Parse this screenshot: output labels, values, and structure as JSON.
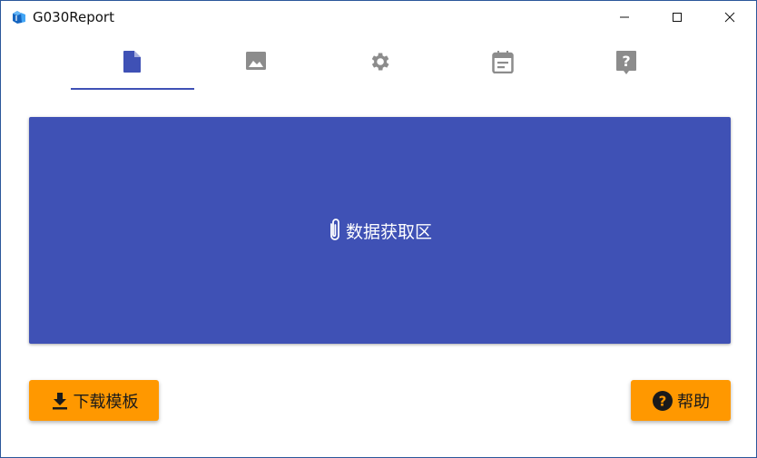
{
  "window": {
    "title": "G030Report"
  },
  "tabs": [
    {
      "icon": "file-icon",
      "active": true
    },
    {
      "icon": "image-icon",
      "active": false
    },
    {
      "icon": "gear-icon",
      "active": false
    },
    {
      "icon": "calendar-icon",
      "active": false
    },
    {
      "icon": "help-chat-icon",
      "active": false
    }
  ],
  "drop_area": {
    "label": "数据获取区",
    "icon": "paperclip-icon"
  },
  "buttons": {
    "download_template": "下载模板",
    "help": "帮助"
  },
  "colors": {
    "primary": "#3f51b5",
    "accent": "#ff9800",
    "tab_inactive": "#8c8c8c"
  }
}
